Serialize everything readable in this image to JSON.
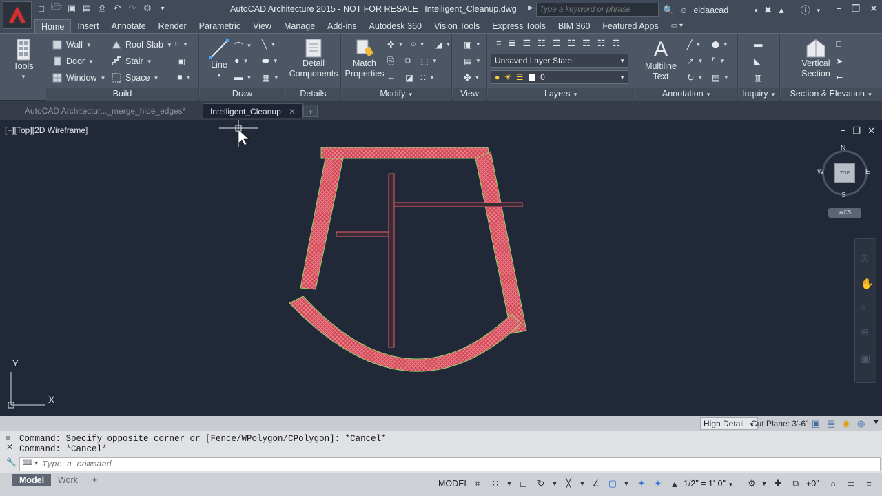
{
  "titlebar": {
    "app_title": "AutoCAD Architecture 2015 - NOT FOR RESALE",
    "file_name": "Intelligent_Cleanup.dwg",
    "search_placeholder": "Type a keyword or phrase",
    "username": "eldaacad"
  },
  "ribbon_tabs": [
    "Home",
    "Insert",
    "Annotate",
    "Render",
    "Parametric",
    "View",
    "Manage",
    "Add-ins",
    "Autodesk 360",
    "Vision Tools",
    "Express Tools",
    "BIM 360",
    "Featured Apps"
  ],
  "ribbon": {
    "tools_label": "Tools",
    "build": {
      "label": "Build",
      "wall": "Wall",
      "door": "Door",
      "window": "Window",
      "roof_slab": "Roof Slab",
      "stair": "Stair",
      "space": "Space"
    },
    "draw": {
      "label": "Draw",
      "line": "Line"
    },
    "details": {
      "label": "Details",
      "detail_components": "Detail\nComponents"
    },
    "modify": {
      "label": "Modify",
      "match_properties": "Match\nProperties"
    },
    "view": {
      "label": "View"
    },
    "layers": {
      "label": "Layers",
      "layer_state": "Unsaved Layer State",
      "current_layer": "0"
    },
    "annotation": {
      "label": "Annotation",
      "multiline_text": "Multiline\nText"
    },
    "inquiry": {
      "label": "Inquiry"
    },
    "section_elevation": {
      "label": "Section & Elevation",
      "vertical_section": "Vertical\nSection"
    }
  },
  "file_tabs": [
    {
      "label": "AutoCAD Architectur..._merge_hide_edges*",
      "active": false
    },
    {
      "label": "Intelligent_Cleanup",
      "active": true
    }
  ],
  "viewport": {
    "label": "[−][Top][2D Wireframe]",
    "viewcube": {
      "n": "N",
      "s": "S",
      "e": "E",
      "w": "W",
      "face": "TOP",
      "wcs": "WCS"
    },
    "ucs_x": "X",
    "ucs_y": "Y"
  },
  "statusband": {
    "detail_level": "High Detail",
    "cut_plane": "Cut Plane: 3'-6\""
  },
  "command": {
    "history": [
      "Command: Specify opposite corner or [Fence/WPolygon/CPolygon]: *Cancel*",
      "Command: *Cancel*"
    ],
    "placeholder": "Type a command"
  },
  "layout_tabs": [
    "Model",
    "Work"
  ],
  "status": {
    "space": "MODEL",
    "scale": "1/2\" = 1'-0\"",
    "elevation": "+0\""
  },
  "colors": {
    "wall_fill": "#e0606e",
    "wall_edge": "#7ec35a",
    "viewport_bg": "#212837",
    "accent": "#c0202a"
  }
}
